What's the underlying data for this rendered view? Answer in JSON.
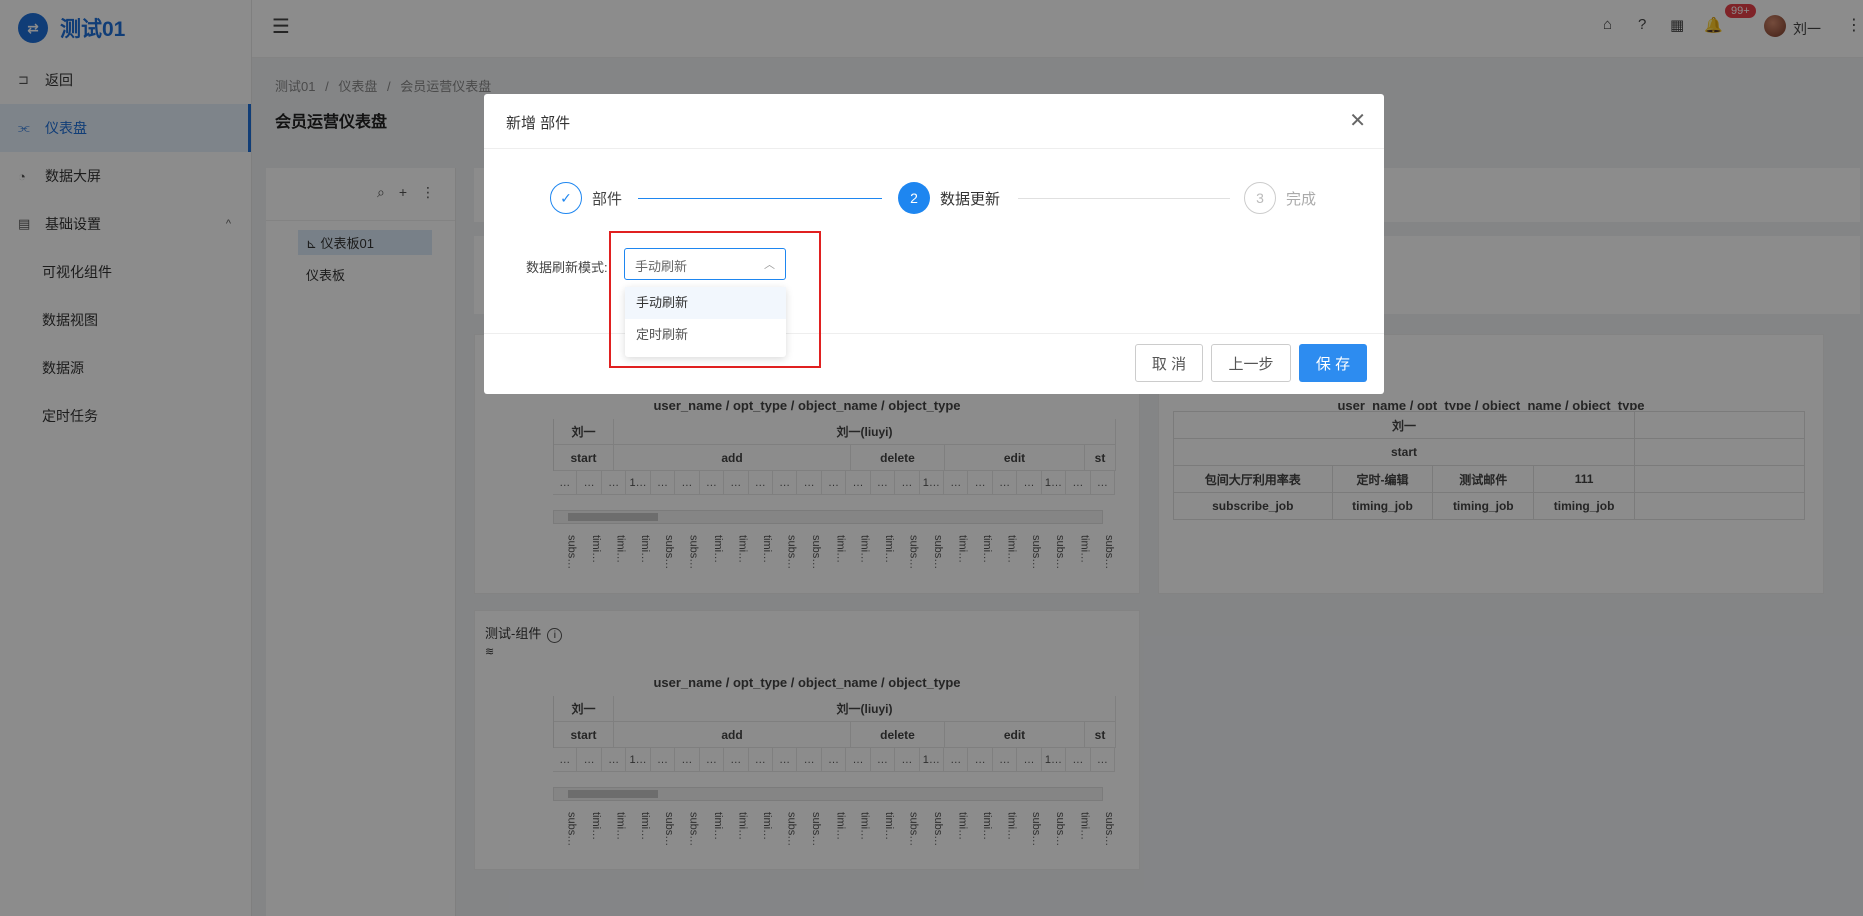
{
  "app": {
    "logo_glyph": "⇄",
    "title": "测试01"
  },
  "sidebar": {
    "items": [
      {
        "label": "返回",
        "icon": "back-icon"
      },
      {
        "label": "仪表盘",
        "icon": "dashboard-icon",
        "active": true
      },
      {
        "label": "数据大屏",
        "icon": "pie-icon"
      },
      {
        "label": "基础设置",
        "icon": "settings-icon",
        "expanded": true
      }
    ],
    "sub_items": [
      {
        "label": "可视化组件"
      },
      {
        "label": "数据视图"
      },
      {
        "label": "数据源"
      },
      {
        "label": "定时任务"
      }
    ]
  },
  "header": {
    "notification_badge": "99+",
    "user_name": "刘一",
    "icons": [
      "home-icon",
      "help-icon",
      "apps-icon",
      "bell-icon"
    ]
  },
  "breadcrumb": [
    "测试01",
    "/",
    "仪表盘",
    "/",
    "会员运营仪表盘"
  ],
  "page": {
    "title": "会员运营仪表盘"
  },
  "tree": {
    "nodes": [
      {
        "label": "仪表板01",
        "selected": true
      },
      {
        "label": "仪表板"
      }
    ]
  },
  "pivot": {
    "title": "user_name / opt_type / object_name / object_type",
    "row_user": "刘一",
    "row_user_full": "刘一(liuyi)",
    "row_op_start": "start",
    "row_op_add": "add",
    "row_op_delete": "delete",
    "row_op_edit": "edit",
    "row_op_st": "st",
    "dots": [
      "…",
      "…",
      "…",
      "1…",
      "…",
      "…",
      "…",
      "…",
      "…",
      "…",
      "…",
      "…",
      "…",
      "…",
      "…",
      "1…",
      "…",
      "…",
      "…",
      "…",
      "1…",
      "…",
      "…"
    ],
    "vertical": [
      "subs…",
      "timi…",
      "timi…",
      "timi…",
      "subs…",
      "subs…",
      "timi…",
      "timi…",
      "timi…",
      "subs…",
      "subs…",
      "timi…",
      "timi…",
      "timi…",
      "subs…",
      "subs…",
      "timi…",
      "timi…",
      "timi…",
      "subs…",
      "subs…",
      "timi…",
      "subs…"
    ]
  },
  "card2": {
    "title": "user_name / opt_type / object_name / object_type",
    "user": "刘一",
    "op": "start",
    "objects": [
      "包间大厅利用率表",
      "定时-编辑",
      "测试邮件",
      "111"
    ],
    "types": [
      "subscribe_job",
      "timing_job",
      "timing_job",
      "timing_job"
    ]
  },
  "card3": {
    "title": "测试-组件"
  },
  "modal": {
    "title": "新增 部件",
    "steps": [
      {
        "label": "部件",
        "status": "done"
      },
      {
        "num": "2",
        "label": "数据更新",
        "status": "active"
      },
      {
        "num": "3",
        "label": "完成",
        "status": "wait"
      }
    ],
    "form": {
      "label": "数据刷新模式:",
      "select_value": "手动刷新"
    },
    "dropdown_options": [
      "手动刷新",
      "定时刷新"
    ],
    "buttons": {
      "cancel": "取 消",
      "prev": "上一步",
      "save": "保 存"
    }
  },
  "colors": {
    "primary": "#1e86f0",
    "brand": "#1e6fd9",
    "highlight": "#e02020",
    "badge": "#e8414a"
  }
}
